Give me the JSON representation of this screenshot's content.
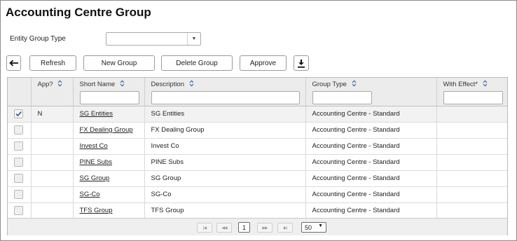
{
  "page": {
    "title": "Accounting Centre Group"
  },
  "filter": {
    "label": "Entity Group Type",
    "value": ""
  },
  "toolbar": {
    "back_icon": "arrow-left-icon",
    "refresh": "Refresh",
    "new_group": "New Group",
    "delete_group": "Delete Group",
    "approve": "Approve",
    "download_icon": "download-icon"
  },
  "table": {
    "columns": [
      "App?",
      "Short Name",
      "Description",
      "Group Type",
      "With Effect*"
    ],
    "rows": [
      {
        "checked": true,
        "app": "N",
        "short_name": "SG Entities",
        "description": "SG Entities",
        "group_type": "Accounting Centre - Standard",
        "with_effect": ""
      },
      {
        "checked": false,
        "app": "",
        "short_name": "FX Dealing Group",
        "description": "FX Dealing Group",
        "group_type": "Accounting Centre - Standard",
        "with_effect": ""
      },
      {
        "checked": false,
        "app": "",
        "short_name": "Invest Co",
        "description": "Invest Co",
        "group_type": "Accounting Centre - Standard",
        "with_effect": ""
      },
      {
        "checked": false,
        "app": "",
        "short_name": "PINE Subs",
        "description": "PINE Subs",
        "group_type": "Accounting Centre - Standard",
        "with_effect": ""
      },
      {
        "checked": false,
        "app": "",
        "short_name": "SG Group",
        "description": "SG Group",
        "group_type": "Accounting Centre - Standard",
        "with_effect": ""
      },
      {
        "checked": false,
        "app": "",
        "short_name": "SG-Co",
        "description": "SG-Co",
        "group_type": "Accounting Centre - Standard",
        "with_effect": ""
      },
      {
        "checked": false,
        "app": "",
        "short_name": "TFS Group",
        "description": "TFS Group",
        "group_type": "Accounting Centre - Standard",
        "with_effect": ""
      }
    ]
  },
  "pager": {
    "first": "|◀",
    "prev": "◀◀",
    "page": "1",
    "next": "▶▶",
    "last": "▶|",
    "page_size": "50"
  }
}
